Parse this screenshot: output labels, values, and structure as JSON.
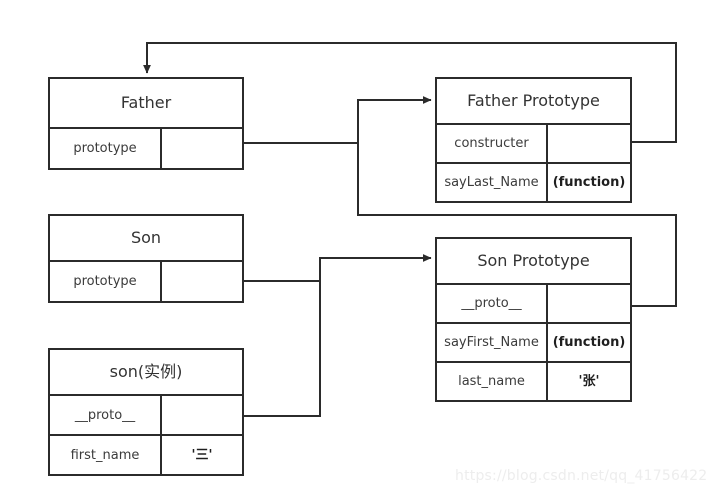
{
  "diagram": {
    "title": "JavaScript prototype chain diagram",
    "line_color": "#2b2b2b",
    "text_color": "#333333",
    "background": "#ffffff",
    "nodes": [
      {
        "id": "father",
        "title": "Father",
        "rows": [
          {
            "key": "prototype",
            "value": ""
          }
        ]
      },
      {
        "id": "son",
        "title": "Son",
        "rows": [
          {
            "key": "prototype",
            "value": ""
          }
        ]
      },
      {
        "id": "son_instance",
        "title": "son(实例)",
        "rows": [
          {
            "key": "__proto__",
            "value": ""
          },
          {
            "key": "first_name",
            "value": "'三'"
          }
        ]
      },
      {
        "id": "father_prototype",
        "title": "Father Prototype",
        "rows": [
          {
            "key": "constructer",
            "value": ""
          },
          {
            "key": "sayLast_Name",
            "value": "(function)"
          }
        ]
      },
      {
        "id": "son_prototype",
        "title": "Son Prototype",
        "rows": [
          {
            "key": "__proto__",
            "value": ""
          },
          {
            "key": "sayFirst_Name",
            "value": "(function)"
          },
          {
            "key": "last_name",
            "value": "'张'"
          }
        ]
      }
    ],
    "edges": [
      {
        "id": "father-prototype-to-father-prototype-box",
        "from": "Father.prototype",
        "to": "Father Prototype"
      },
      {
        "id": "father-prototype-constructer-to-father",
        "from": "Father Prototype.constructer",
        "to": "Father"
      },
      {
        "id": "son-prototype-to-son-prototype-box",
        "from": "Son.prototype",
        "to": "Son Prototype"
      },
      {
        "id": "son-instance-proto-to-son-prototype-box",
        "from": "son(实例).__proto__",
        "to": "Son Prototype"
      },
      {
        "id": "son-prototype-proto-to-father-prototype-box",
        "from": "Son Prototype.__proto__",
        "to": "Father Prototype"
      }
    ]
  },
  "watermark": {
    "text": "https://blog.csdn.net/qq_41756422"
  }
}
